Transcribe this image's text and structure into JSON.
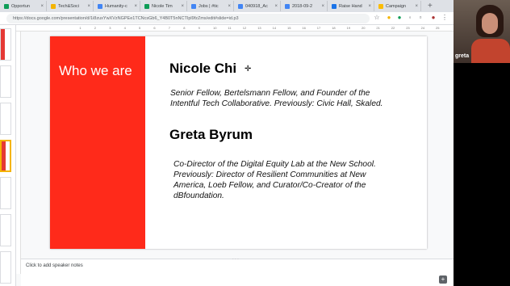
{
  "browser": {
    "tabs": [
      {
        "label": "Opportun",
        "color": "#0f9d58"
      },
      {
        "label": "Tech&Soci",
        "color": "#f4b400"
      },
      {
        "label": "Humanity-c",
        "color": "#4285f4"
      },
      {
        "label": "Nicole Tim",
        "color": "#0f9d58"
      },
      {
        "label": "Jobs | #tic",
        "color": "#4285f4"
      },
      {
        "label": "040918_Ac",
        "color": "#4285f4"
      },
      {
        "label": "2018-09-2",
        "color": "#4285f4"
      },
      {
        "label": "Raise Hand",
        "color": "#1a73e8"
      },
      {
        "label": "Campaign",
        "color": "#fbbc04"
      }
    ],
    "url": "https://docs.google.com/presentation/d/1i8zuxYwXVzNGPEe1TCNcsGb6_Y4B0T5nNCTIpl9fzZms/edit#slide=id.p3"
  },
  "slide": {
    "heading": "Who we are",
    "person1": {
      "name": "Nicole Chi",
      "desc_lines": [
        "Senior Fellow, Bertelsmann Fellow, and Founder of the",
        "Intentful Tech Collaborative. Previously: Civic Hall, Skaled."
      ]
    },
    "person2": {
      "name": "Greta Byrum",
      "desc_lines": [
        "Co-Director of the Digital Equity Lab at the New School.",
        "Previously: Director of Resilient Communities at New",
        "America, Loeb Fellow, and Curator/Co-Creator of the",
        "dBfoundation."
      ]
    }
  },
  "notes": {
    "placeholder": "Click to add speaker notes"
  },
  "video": {
    "participant_name": "greta"
  },
  "colors": {
    "accent_red": "#ff2a1a"
  }
}
